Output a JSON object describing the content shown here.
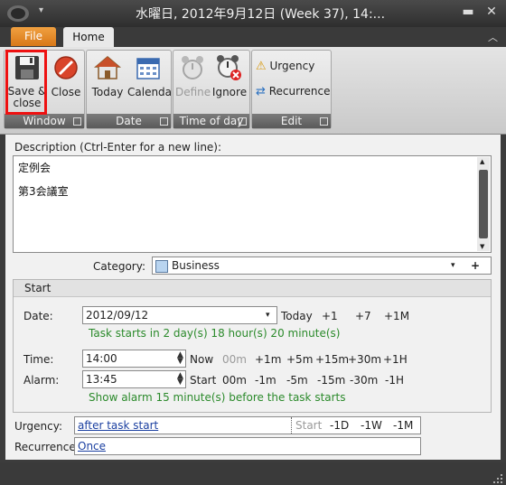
{
  "window": {
    "title": "水曜日, 2012年9月12日 (Week 37), 14:..."
  },
  "tabs": [
    {
      "label": "File"
    },
    {
      "label": "Home"
    }
  ],
  "ribbon": {
    "groups": [
      {
        "label": "Window",
        "buttons": [
          "Save &",
          "close",
          "Close"
        ]
      },
      {
        "label": "Date",
        "buttons": [
          "Today",
          "Calendar"
        ]
      },
      {
        "label": "Time of day",
        "buttons": [
          "Define",
          "Ignore"
        ]
      },
      {
        "label": "Edit",
        "buttons": [
          "Urgency",
          "Recurrence"
        ]
      }
    ]
  },
  "description": {
    "label": "Description (Ctrl-Enter for a new line):",
    "lines": [
      "定例会",
      "第3会議室"
    ]
  },
  "category": {
    "label": "Category:",
    "value": "Business",
    "add": "+"
  },
  "start": {
    "header": "Start",
    "date": {
      "label": "Date:",
      "value": "2012/09/12",
      "shortcuts": [
        "Today",
        "+1",
        "+7",
        "+1M"
      ]
    },
    "date_info": "Task starts in 2 day(s) 18 hour(s) 20 minute(s)",
    "time": {
      "label": "Time:",
      "value": "14:00",
      "shortcuts": [
        "Now",
        "00m",
        "+1m",
        "+5m",
        "+15m",
        "+30m",
        "+1H"
      ]
    },
    "alarm": {
      "label": "Alarm:",
      "value": "13:45",
      "shortcuts": [
        "Start",
        "00m",
        "-1m",
        "-5m",
        "-15m",
        "-30m",
        "-1H"
      ]
    },
    "alarm_info": "Show alarm 15 minute(s) before the task starts"
  },
  "urgency": {
    "label": "Urgency:",
    "value": "after task start",
    "shortcuts": [
      "Start",
      "-1D",
      "-1W",
      "-1M"
    ]
  },
  "recurrence": {
    "label": "Recurrence:",
    "value": "Once"
  }
}
